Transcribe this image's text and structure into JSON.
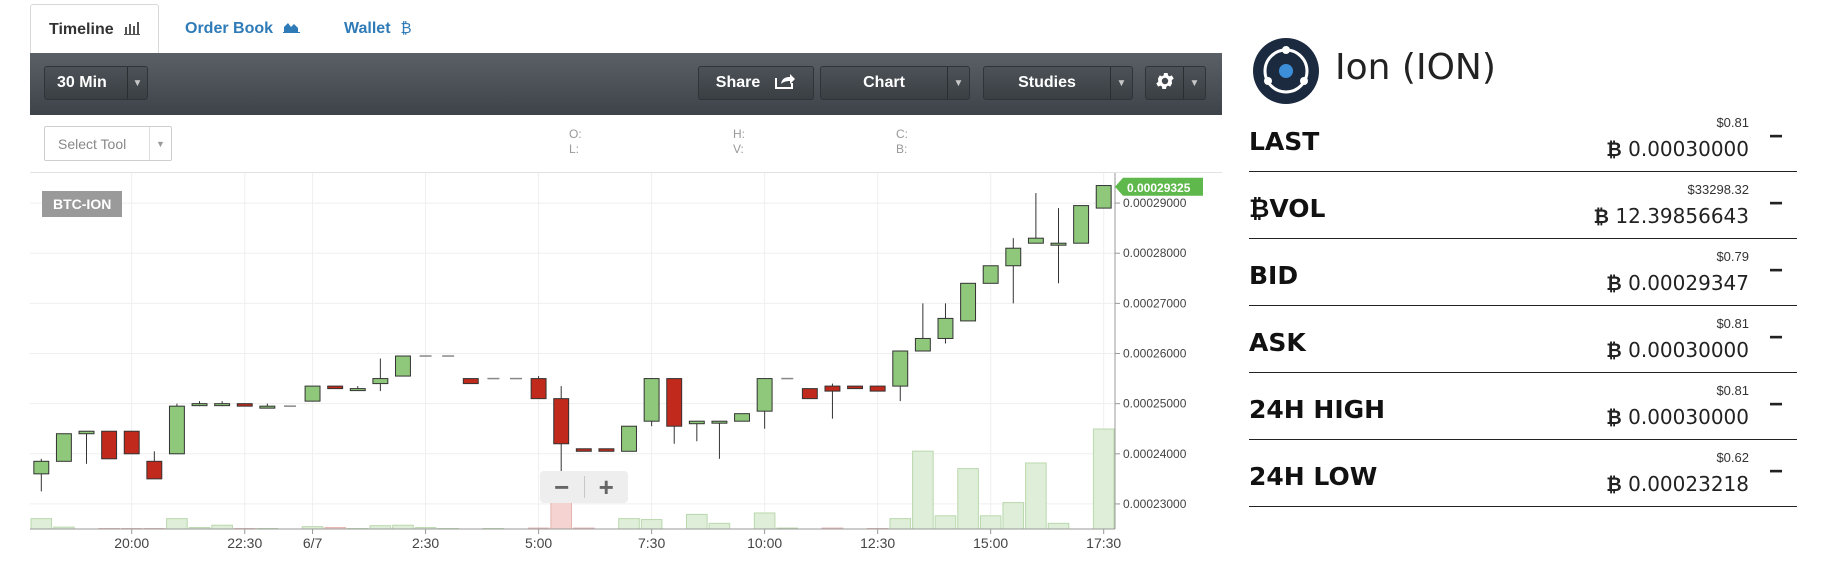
{
  "tabs": [
    {
      "label": "Timeline",
      "icon": "bar-chart-icon",
      "glyph": "📊",
      "active": true
    },
    {
      "label": "Order Book",
      "icon": "area-chart-icon",
      "glyph": "◭",
      "active": false
    },
    {
      "label": "Wallet",
      "icon": "bitcoin-icon",
      "glyph": "₿",
      "active": false
    }
  ],
  "toolbar": {
    "interval": "30 Min",
    "share": "Share",
    "chart": "Chart",
    "studies": "Studies"
  },
  "infobar": {
    "select_tool": "Select Tool",
    "o_label": "O:",
    "l_label": "L:",
    "h_label": "H:",
    "v_label": "V:",
    "c_label": "C:",
    "b_label": "B:"
  },
  "chart": {
    "pair": "BTC-ION",
    "zoom_out": "−",
    "zoom_in": "+"
  },
  "chart_data": {
    "type": "candlestick",
    "title": "",
    "ylim": [
      0.000225,
      0.000296
    ],
    "yticks": [
      0.00023,
      0.00024,
      0.00025,
      0.00026,
      0.00027,
      0.00028,
      0.00029
    ],
    "ytick_labels": [
      "0.00023000",
      "0.00024000",
      "0.00025000",
      "0.00026000",
      "0.00027000",
      "0.00028000",
      "0.00029000"
    ],
    "last_price_label": "0.00029325",
    "last_price": 0.00029325,
    "xtick_labels": [
      "20:00",
      "22:30",
      "6/7",
      "2:30",
      "5:00",
      "7:30",
      "10:00",
      "12:30",
      "15:00",
      "17:30"
    ],
    "xtick_index": [
      4.5,
      9.5,
      12.5,
      17.5,
      22.5,
      27.5,
      32.5,
      37.5,
      42.5,
      47.5
    ],
    "colors": {
      "up": "#8fc87a",
      "down": "#c0291b",
      "up_vol": "#dfeed8",
      "down_vol": "#f4d3d0",
      "grid": "#efefef"
    },
    "candles": [
      {
        "o": 0.000236,
        "h": 0.000239,
        "l": 0.0002325,
        "c": 0.0002385,
        "v": 0.22
      },
      {
        "o": 0.0002385,
        "h": 0.000244,
        "l": 0.0002385,
        "c": 0.000244,
        "v": 0.04
      },
      {
        "o": 0.000244,
        "h": 0.0002445,
        "l": 0.000238,
        "c": 0.0002445,
        "v": 0.0
      },
      {
        "o": 0.0002445,
        "h": 0.0002445,
        "l": 0.000239,
        "c": 0.000239,
        "v": 0.01
      },
      {
        "o": 0.0002445,
        "h": 0.0002445,
        "l": 0.00024,
        "c": 0.00024,
        "v": 0.01
      },
      {
        "o": 0.0002385,
        "h": 0.0002405,
        "l": 0.000235,
        "c": 0.000235,
        "v": 0.01
      },
      {
        "o": 0.00024,
        "h": 0.00025,
        "l": 0.00024,
        "c": 0.0002495,
        "v": 0.22
      },
      {
        "o": 0.00025,
        "h": 0.0002505,
        "l": 0.0002495,
        "c": 0.00025,
        "v": 0.03
      },
      {
        "o": 0.00025,
        "h": 0.0002505,
        "l": 0.0002495,
        "c": 0.00025,
        "v": 0.08
      },
      {
        "o": 0.00025,
        "h": 0.00025,
        "l": 0.0002495,
        "c": 0.0002495,
        "v": 0.01
      },
      {
        "o": 0.0002495,
        "h": 0.00025,
        "l": 0.0002495,
        "c": 0.0002495,
        "v": 0.01
      },
      {
        "o": 0.0002495,
        "h": 0.0002495,
        "l": 0.0002495,
        "c": 0.0002495,
        "v": 0.0
      },
      {
        "o": 0.0002505,
        "h": 0.0002535,
        "l": 0.0002505,
        "c": 0.0002535,
        "v": 0.05
      },
      {
        "o": 0.0002535,
        "h": 0.0002535,
        "l": 0.000253,
        "c": 0.000253,
        "v": 0.03
      },
      {
        "o": 0.000253,
        "h": 0.0002535,
        "l": 0.000253,
        "c": 0.000253,
        "v": 0.01
      },
      {
        "o": 0.000254,
        "h": 0.000259,
        "l": 0.0002525,
        "c": 0.000255,
        "v": 0.07
      },
      {
        "o": 0.0002555,
        "h": 0.0002595,
        "l": 0.0002555,
        "c": 0.0002595,
        "v": 0.08
      },
      {
        "o": 0.0002595,
        "h": 0.0002595,
        "l": 0.0002595,
        "c": 0.0002595,
        "v": 0.03
      },
      {
        "o": 0.0002595,
        "h": 0.0002595,
        "l": 0.0002595,
        "c": 0.0002595,
        "v": 0.01
      },
      {
        "o": 0.000255,
        "h": 0.000255,
        "l": 0.000254,
        "c": 0.000254,
        "v": 0.0
      },
      {
        "o": 0.000255,
        "h": 0.000255,
        "l": 0.000255,
        "c": 0.000255,
        "v": 0.01
      },
      {
        "o": 0.000255,
        "h": 0.000255,
        "l": 0.000255,
        "c": 0.000255,
        "v": 0.0
      },
      {
        "o": 0.000255,
        "h": 0.0002555,
        "l": 0.000251,
        "c": 0.000251,
        "v": 0.02
      },
      {
        "o": 0.000251,
        "h": 0.0002535,
        "l": 0.000233,
        "c": 0.000242,
        "v": 0.62
      },
      {
        "o": 0.000241,
        "h": 0.000241,
        "l": 0.0002405,
        "c": 0.0002405,
        "v": 0.02
      },
      {
        "o": 0.000241,
        "h": 0.000241,
        "l": 0.0002405,
        "c": 0.0002405,
        "v": 0.0
      },
      {
        "o": 0.0002405,
        "h": 0.0002455,
        "l": 0.0002405,
        "c": 0.0002455,
        "v": 0.22
      },
      {
        "o": 0.0002465,
        "h": 0.000255,
        "l": 0.0002455,
        "c": 0.000255,
        "v": 0.2
      },
      {
        "o": 0.000255,
        "h": 0.000255,
        "l": 0.000242,
        "c": 0.0002455,
        "v": 0.0
      },
      {
        "o": 0.000246,
        "h": 0.0002465,
        "l": 0.0002425,
        "c": 0.0002465,
        "v": 0.31
      },
      {
        "o": 0.0002465,
        "h": 0.0002465,
        "l": 0.000239,
        "c": 0.0002465,
        "v": 0.12
      },
      {
        "o": 0.0002465,
        "h": 0.000248,
        "l": 0.0002465,
        "c": 0.000248,
        "v": 0.0
      },
      {
        "o": 0.0002485,
        "h": 0.000255,
        "l": 0.000245,
        "c": 0.000255,
        "v": 0.34
      },
      {
        "o": 0.000255,
        "h": 0.000255,
        "l": 0.000255,
        "c": 0.000255,
        "v": 0.02
      },
      {
        "o": 0.000253,
        "h": 0.000253,
        "l": 0.000251,
        "c": 0.000251,
        "v": 0.0
      },
      {
        "o": 0.0002535,
        "h": 0.000254,
        "l": 0.000247,
        "c": 0.0002525,
        "v": 0.02
      },
      {
        "o": 0.0002535,
        "h": 0.0002535,
        "l": 0.000253,
        "c": 0.000253,
        "v": 0.0
      },
      {
        "o": 0.0002535,
        "h": 0.0002535,
        "l": 0.0002525,
        "c": 0.0002525,
        "v": 0.01
      },
      {
        "o": 0.0002535,
        "h": 0.0002605,
        "l": 0.0002505,
        "c": 0.0002605,
        "v": 0.22
      },
      {
        "o": 0.0002605,
        "h": 0.00027,
        "l": 0.0002605,
        "c": 0.000263,
        "v": 1.65
      },
      {
        "o": 0.000263,
        "h": 0.00027,
        "l": 0.000262,
        "c": 0.000267,
        "v": 0.28
      },
      {
        "o": 0.0002665,
        "h": 0.000274,
        "l": 0.0002665,
        "c": 0.000274,
        "v": 1.28
      },
      {
        "o": 0.000274,
        "h": 0.0002775,
        "l": 0.000274,
        "c": 0.0002775,
        "v": 0.28
      },
      {
        "o": 0.0002775,
        "h": 0.000283,
        "l": 0.00027,
        "c": 0.000281,
        "v": 0.56
      },
      {
        "o": 0.000282,
        "h": 0.000292,
        "l": 0.000282,
        "c": 0.000283,
        "v": 1.4
      },
      {
        "o": 0.000282,
        "h": 0.000289,
        "l": 0.000274,
        "c": 0.000282,
        "v": 0.12
      },
      {
        "o": 0.000282,
        "h": 0.0002895,
        "l": 0.000282,
        "c": 0.0002895,
        "v": 0.0
      },
      {
        "o": 0.000289,
        "h": 0.0002935,
        "l": 0.000289,
        "c": 0.0002935,
        "v": 2.12
      }
    ]
  },
  "market": {
    "name": "Ion (ION)",
    "stats": [
      {
        "label": "LAST",
        "usd": "$0.81",
        "btc": "0.00030000"
      },
      {
        "label": "₿VOL",
        "usd": "$33298.32",
        "btc": "12.39856643"
      },
      {
        "label": "BID",
        "usd": "$0.79",
        "btc": "0.00029347"
      },
      {
        "label": "ASK",
        "usd": "$0.81",
        "btc": "0.00030000"
      },
      {
        "label": "24H HIGH",
        "usd": "$0.81",
        "btc": "0.00030000"
      },
      {
        "label": "24H LOW",
        "usd": "$0.62",
        "btc": "0.00023218"
      }
    ],
    "btc_symbol": "₿",
    "minus": "−"
  }
}
